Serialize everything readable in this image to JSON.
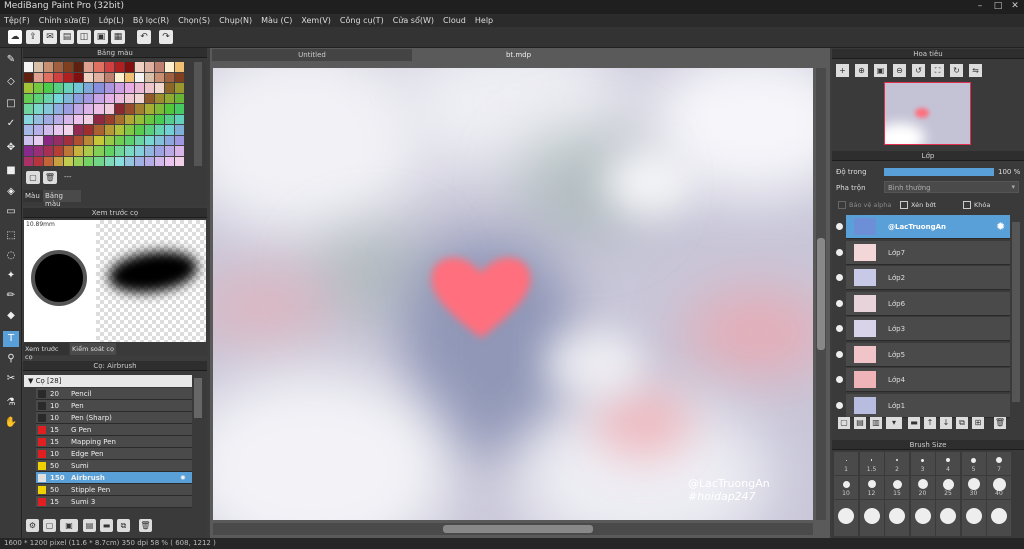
{
  "window": {
    "title": "MediBang Paint Pro (32bit)"
  },
  "menu": [
    "Tệp(F)",
    "Chỉnh sửa(E)",
    "Lớp(L)",
    "Bộ lọc(R)",
    "Chọn(S)",
    "Chụp(N)",
    "Màu (C)",
    "Xem(V)",
    "Công cụ(T)",
    "Cửa sổ(W)",
    "Cloud",
    "Help"
  ],
  "left_panels": {
    "palette_title": "Bảng màu",
    "palette_tabs": [
      "Màu",
      "Bảng màu"
    ],
    "palette_extra": "---",
    "preview_title": "Xem trước cọ",
    "preview_size": "10.89mm",
    "preview_tabs": [
      "Xem trước cọ",
      "Kiểm soát cọ"
    ],
    "brush_title": "Cọ: Airbrush",
    "brush_group": "Cọ [28]",
    "brushes": [
      {
        "size": "20",
        "name": "Pencil",
        "color": "#2a2a2a"
      },
      {
        "size": "10",
        "name": "Pen",
        "color": "#2a2a2a"
      },
      {
        "size": "10",
        "name": "Pen (Sharp)",
        "color": "#2a2a2a"
      },
      {
        "size": "15",
        "name": "G Pen",
        "color": "#e02020"
      },
      {
        "size": "15",
        "name": "Mapping Pen",
        "color": "#e02020"
      },
      {
        "size": "10",
        "name": "Edge Pen",
        "color": "#e02020"
      },
      {
        "size": "50",
        "name": "Sumi",
        "color": "#f0d000"
      },
      {
        "size": "150",
        "name": "Airbrush",
        "color": "#e0e0e0"
      },
      {
        "size": "50",
        "name": "Stipple Pen",
        "color": "#f0d000"
      },
      {
        "size": "15",
        "name": "Sumi 3",
        "color": "#e02020"
      }
    ],
    "selected_brush": 7
  },
  "canvas": {
    "tabs": [
      "Untitled",
      "bt.mdp"
    ],
    "watermark_1": "@LacTruongAn",
    "watermark_2": "#hoidap247"
  },
  "right_panels": {
    "navigator_title": "Hoa tiêu",
    "layer_title": "Lớp",
    "opacity_label": "Độ trong",
    "opacity_value": "100 %",
    "blend_label": "Pha trộn",
    "blend_value": "Bình thường",
    "checks": [
      "Bảo vệ alpha",
      "Xén bớt",
      "Khóa"
    ],
    "layers": [
      "@LacTruongAn",
      "Lớp7",
      "Lớp2",
      "Lớp6",
      "Lớp3",
      "Lớp5",
      "Lớp4",
      "Lớp1"
    ],
    "selected_layer": 0,
    "brush_size_title": "Brush Size",
    "brush_sizes_row1": [
      "1",
      "1.5",
      "2",
      "3",
      "4",
      "5",
      "7"
    ],
    "brush_sizes_row2": [
      "10",
      "12",
      "15",
      "20",
      "25",
      "30",
      "40"
    ]
  },
  "status": "1600 * 1200 pixel   (11.6 * 8.7cm)  350 dpi  58 %  ( 608, 1212 )",
  "colors": {
    "accent": "#5aa0d8",
    "heart": "#ff6f7d"
  }
}
